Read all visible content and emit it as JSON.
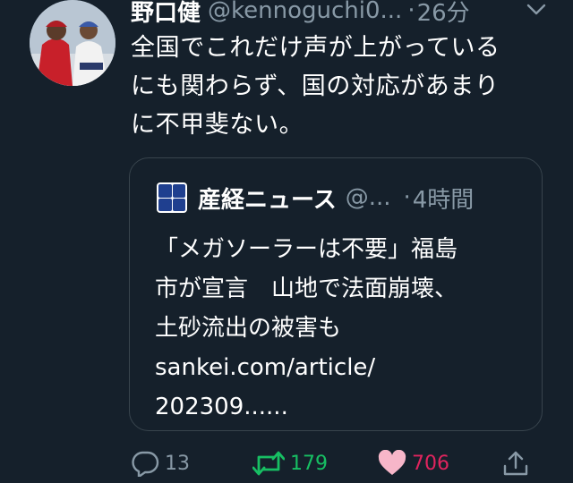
{
  "tweet": {
    "display_name": "野口健",
    "handle": "@kennoguchi0...",
    "separator": "·",
    "time": "26分",
    "text_lines": [
      "全国でこれだけ声が上がっている",
      "にも関わらず、国の対応があまり",
      "に不甲斐ない。"
    ]
  },
  "quote": {
    "name": "産経ニュース",
    "handle": "@...",
    "separator": "·",
    "time": "4時間",
    "text_lines": [
      "「メガソーラーは不要」福島",
      "市が宣言　山地で法面崩壊、",
      "土砂流出の被害も",
      "sankei.com/article/",
      "202309......"
    ]
  },
  "actions": {
    "reply_count": "13",
    "retweet_count": "179",
    "like_count": "706"
  },
  "icons": {
    "caret": "chevron-down-icon",
    "reply": "reply-icon",
    "retweet": "retweet-icon",
    "like": "heart-icon",
    "share": "share-icon"
  },
  "colors": {
    "background": "#15202b",
    "secondary_text": "#8899a6",
    "retweet": "#17bf63",
    "like": "#e0245e",
    "card_border": "#38444d"
  }
}
